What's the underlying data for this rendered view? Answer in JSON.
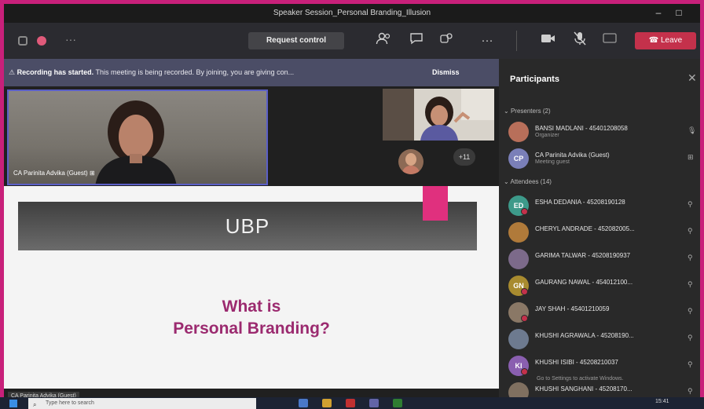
{
  "window": {
    "title": "Speaker Session_Personal Branding_Illusion"
  },
  "toolbar": {
    "more_left": "···",
    "request_control": "Request control",
    "more": "···",
    "leave": "Leave"
  },
  "banner": {
    "bold": "Recording has started.",
    "text": "This meeting is being recorded. By joining, you are giving con...",
    "dismiss": "Dismiss"
  },
  "video": {
    "main_caption": "CA Parinita Advika (Guest)",
    "overflow_count": "+11"
  },
  "slide": {
    "title": "UBP",
    "line1": "What is",
    "line2": "Personal Branding?",
    "presenter_caption": "CA Parinita Advika (Guest)"
  },
  "panel": {
    "title": "Participants",
    "presenters_header": "Presenters (2)",
    "attendees_header": "Attendees (14)",
    "presenters": [
      {
        "name": "BANSI MADLANI - 45401208058",
        "sub": "Organizer",
        "initials": "",
        "color": "#b86f5a"
      },
      {
        "name": "CA Parinita Advika (Guest)",
        "sub": "Meeting guest",
        "initials": "CP",
        "color": "#7a7fb8"
      }
    ],
    "attendees": [
      {
        "name": "ESHA DEDANIA - 45208190128",
        "initials": "ED",
        "color": "#3d9a8a"
      },
      {
        "name": "CHERYL ANDRADE - 452082005...",
        "initials": "",
        "color": "#b07a3a"
      },
      {
        "name": "GARIMA TALWAR - 45208190937",
        "initials": "",
        "color": "#7c6a8a"
      },
      {
        "name": "GAURANG NAWAL - 454012100...",
        "initials": "GN",
        "color": "#a88b2f"
      },
      {
        "name": "JAY SHAH - 45401210059",
        "initials": "",
        "color": "#8a7866"
      },
      {
        "name": "KHUSHI AGRAWALA - 45208190...",
        "initials": "",
        "color": "#6d7a8f"
      },
      {
        "name": "KHUSHI ISIBI - 45208210037",
        "initials": "KI",
        "color": "#8a5fb0"
      },
      {
        "name": "KHUSHI SANGHANI - 45208170...",
        "initials": "",
        "color": "#807060"
      }
    ],
    "activate_text": "Go to Settings to activate Windows."
  },
  "taskbar": {
    "search_placeholder": "Type here to search",
    "time": "15:41"
  }
}
